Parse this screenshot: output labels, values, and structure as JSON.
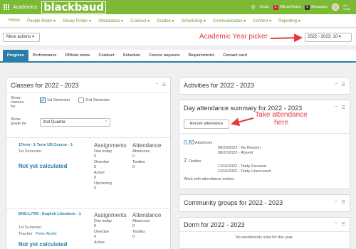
{
  "topbar": {
    "app_name": "Academics",
    "logo": "blackbaud",
    "goals_label": "Goals",
    "notes_count": "3",
    "notes_label": "Official Notes",
    "messages_count": "0",
    "messages_label": "Messages",
    "user_name": "Ani Smith"
  },
  "nav": [
    {
      "label": "Home"
    },
    {
      "label": "People finder ▾"
    },
    {
      "label": "Group Finder ▾"
    },
    {
      "label": "Attendance ▾"
    },
    {
      "label": "Conduct ▾"
    },
    {
      "label": "Grades ▾"
    },
    {
      "label": "Scheduling ▾"
    },
    {
      "label": "Communication ▾"
    },
    {
      "label": "Content ▾"
    },
    {
      "label": "Reporting ▾"
    }
  ],
  "actions": {
    "more_actions": "More actions ▾",
    "year_value": "2022 - 2023: 10 ▾"
  },
  "annotations": {
    "year_picker": "Academic Year picker",
    "take_attendance": "Take attendance here"
  },
  "tabs": [
    {
      "label": "Progress",
      "active": true
    },
    {
      "label": "Performance"
    },
    {
      "label": "Official notes"
    },
    {
      "label": "Conduct"
    },
    {
      "label": "Schedule"
    },
    {
      "label": "Course requests"
    },
    {
      "label": "Requirements"
    },
    {
      "label": "Contact card"
    }
  ],
  "classes": {
    "title": "Classes for 2022 - 2023",
    "show_classes_label": "Show classes for",
    "sem1": "1st Semester",
    "sem2": "2nd Semester",
    "show_grade_label": "Show grade for",
    "grade_value": "2nd Quarter",
    "assignments_head": "Assignments",
    "attendance_head": "Attendance",
    "courses": [
      {
        "name": "1Term - 1 Term US Course - 1",
        "term": "1st Semester",
        "grade": "Not yet calculated",
        "due_today_label": "Due today",
        "due_today": "0",
        "overdue_label": "Overdue",
        "overdue": "0",
        "active_label": "Active",
        "active": "0",
        "upcoming_label": "Upcoming",
        "upcoming": "0",
        "absences_label": "Absences",
        "absences": "0",
        "tardies_label": "Tardies",
        "tardies": "0"
      },
      {
        "name": "ENG-LIT09 - English Literature - 1",
        "term": "1st Semester",
        "teacher_label": "Teacher",
        "teacher": "Peter Abelle",
        "grade": "Not yet calculated",
        "due_today_label": "Due today",
        "due_today": "0",
        "overdue_label": "Overdue",
        "overdue": "0",
        "active_label": "Active",
        "absences_label": "Absences",
        "absences": "0",
        "tardies_label": "Tardies",
        "tardies": "0"
      }
    ]
  },
  "activities": {
    "title": "Activities for 2022 - 2023"
  },
  "day_attendance": {
    "title": "Day attendance summary for 2022 - 2023",
    "record_button": "Record attendance",
    "absences_count": "0.83",
    "absences_label": "Absences",
    "absence_entries": [
      "08/29/2022 - No Reason",
      "08/22/2022 - Absent"
    ],
    "tardies_count": "2",
    "tardies_label": "Tardies",
    "tardy_entries": [
      "11/15/2022 - Tardy Excused",
      "11/15/2022 - Tardy Unexcused"
    ],
    "work_link": "Work with attendance entries"
  },
  "community": {
    "title": "Community groups for 2022 - 2023"
  },
  "dorm": {
    "title": "Dorm for 2022 - 2023",
    "empty": "No enrollments exist for this year."
  },
  "colors": {
    "brand_green": "#7cba35",
    "accent_blue": "#2a7fa8",
    "annotation_red": "#e23b3b"
  }
}
